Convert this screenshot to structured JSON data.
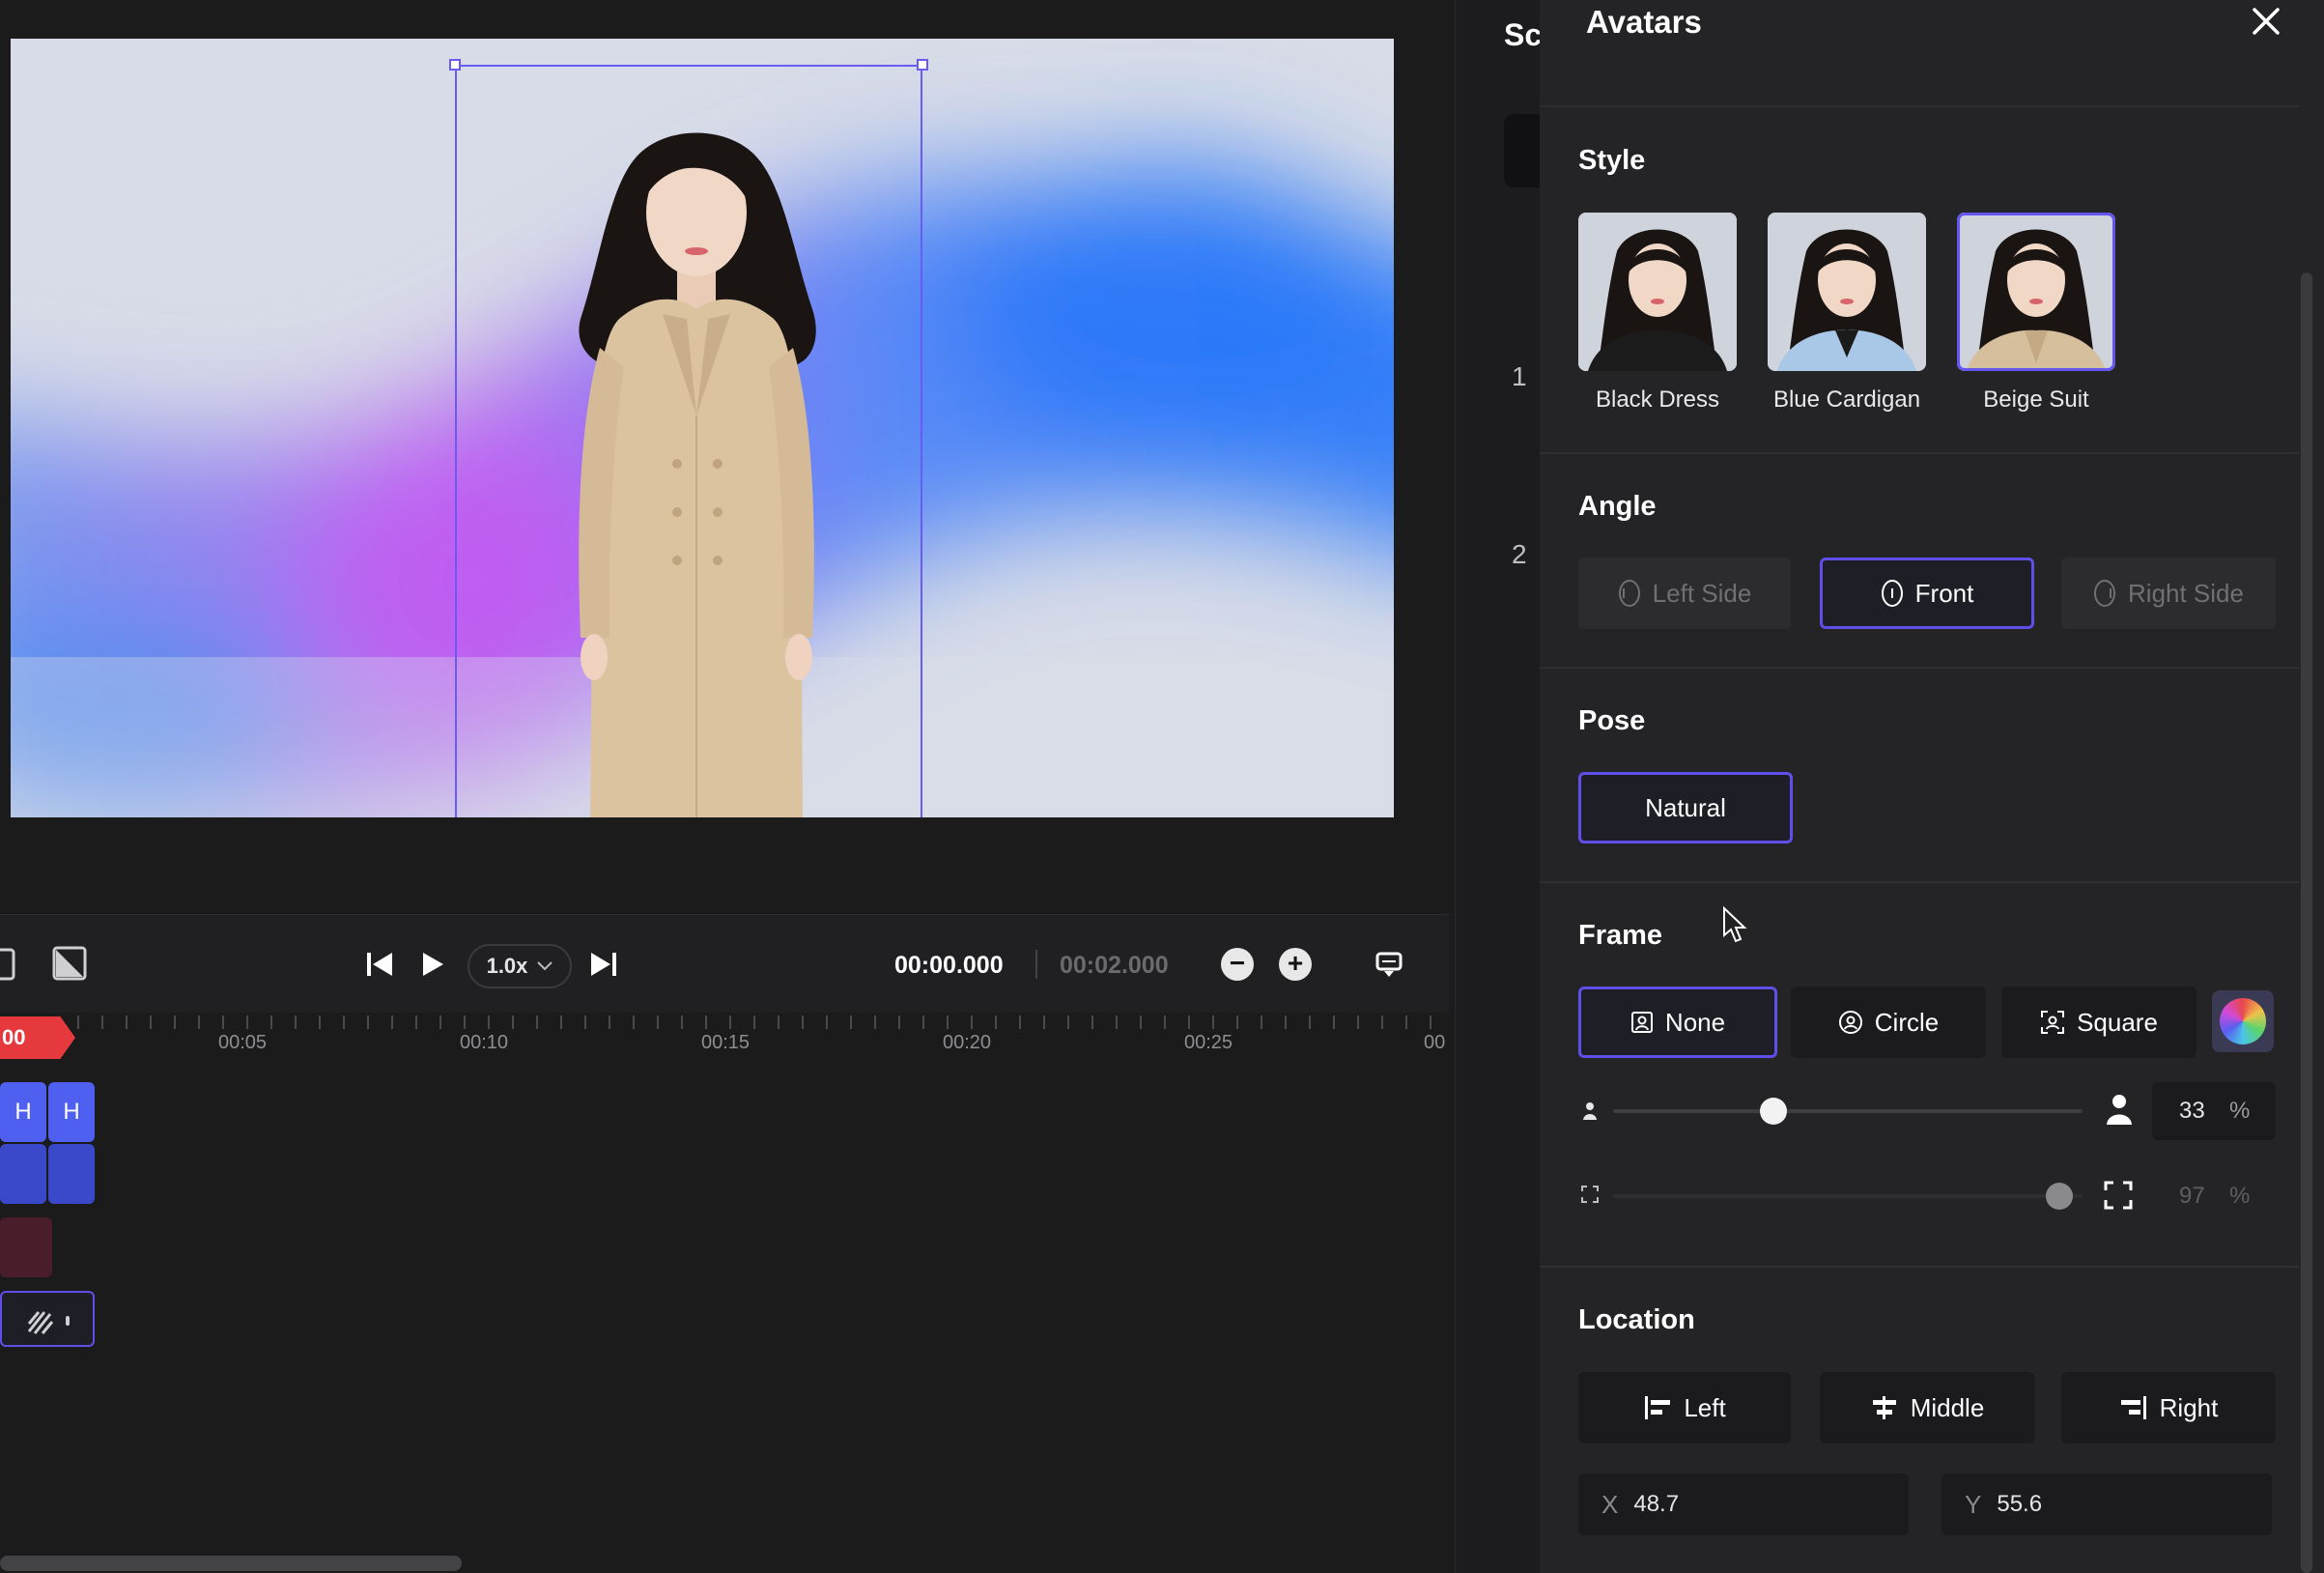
{
  "panel": {
    "title": "Avatars",
    "style": {
      "title": "Style",
      "options": [
        {
          "label": "Black Dress",
          "selected": false,
          "outfit": "#1b1b1b"
        },
        {
          "label": "Blue Cardigan",
          "selected": false,
          "outfit": "#a9c7e6"
        },
        {
          "label": "Beige Suit",
          "selected": true,
          "outfit": "#d6bf9c"
        }
      ]
    },
    "angle": {
      "title": "Angle",
      "options": [
        {
          "label": "Left Side",
          "selected": false
        },
        {
          "label": "Front",
          "selected": true
        },
        {
          "label": "Right Side",
          "selected": false
        }
      ]
    },
    "pose": {
      "title": "Pose",
      "options": [
        {
          "label": "Natural",
          "selected": true
        }
      ]
    },
    "frame": {
      "title": "Frame",
      "options": [
        {
          "label": "None",
          "selected": true
        },
        {
          "label": "Circle",
          "selected": false
        },
        {
          "label": "Square",
          "selected": false
        }
      ],
      "size_value": "33",
      "size_level": 0.33,
      "fill_value": "97",
      "fill_level": 0.97,
      "unit": "%"
    },
    "location": {
      "title": "Location",
      "options": [
        {
          "label": "Left"
        },
        {
          "label": "Middle"
        },
        {
          "label": "Right"
        }
      ],
      "x_label": "X",
      "x_value": "48.7",
      "y_label": "Y",
      "y_value": "55.6"
    }
  },
  "scenes": {
    "title": "Sc",
    "numbers": [
      "1",
      "2"
    ]
  },
  "player": {
    "speed": "1.0x",
    "current_time": "00:00.000",
    "total_time": "00:02.000"
  },
  "timeline": {
    "playhead_label": "00",
    "tick_labels": [
      "00:05",
      "00:10",
      "00:15",
      "00:20",
      "00:25",
      "00"
    ],
    "clip_letters": [
      "H",
      "H"
    ]
  },
  "colors": {
    "accent": "#5f4fe8",
    "playhead": "#e5393e",
    "panel_bg": "#242426"
  }
}
